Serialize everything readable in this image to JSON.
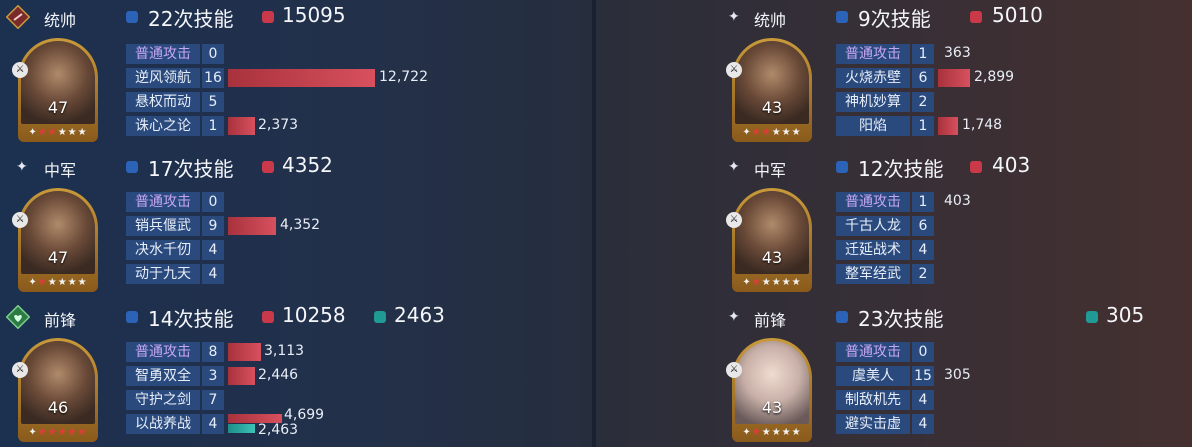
{
  "left": {
    "commander": {
      "role": "统帅",
      "casts": "22次技能",
      "damage": "15095",
      "level": "47",
      "skills": [
        {
          "name": "普通攻击",
          "count": "0",
          "dmg": "",
          "dmg_fraction": 0
        },
        {
          "name": "逆风领航",
          "count": "16",
          "dmg": "12,722",
          "dmg_fraction": 1.0
        },
        {
          "name": "悬权而动",
          "count": "5",
          "dmg": "",
          "dmg_fraction": 0
        },
        {
          "name": "诛心之论",
          "count": "1",
          "dmg": "2,373",
          "dmg_fraction": 0.19
        }
      ]
    },
    "middle": {
      "role": "中军",
      "casts": "17次技能",
      "damage": "4352",
      "level": "47",
      "skills": [
        {
          "name": "普通攻击",
          "count": "0",
          "dmg": "",
          "dmg_fraction": 0
        },
        {
          "name": "销兵偃武",
          "count": "9",
          "dmg": "4,352",
          "dmg_fraction": 0.34
        },
        {
          "name": "决水千仞",
          "count": "4",
          "dmg": "",
          "dmg_fraction": 0
        },
        {
          "name": "动于九天",
          "count": "4",
          "dmg": "",
          "dmg_fraction": 0
        }
      ]
    },
    "vanguard": {
      "role": "前锋",
      "casts": "14次技能",
      "damage": "10258",
      "heal": "2463",
      "level": "46",
      "skills": [
        {
          "name": "普通攻击",
          "count": "8",
          "dmg": "3,113",
          "dmg_fraction": 0.24
        },
        {
          "name": "智勇双全",
          "count": "3",
          "dmg": "2,446",
          "dmg_fraction": 0.19
        },
        {
          "name": "守护之剑",
          "count": "7",
          "dmg": "",
          "dmg_fraction": 0
        },
        {
          "name": "以战养战",
          "count": "4",
          "dmg": "4,699",
          "dmg_fraction": 0.37,
          "heal": "2,463",
          "heal_fraction": 0.19
        }
      ]
    }
  },
  "right": {
    "commander": {
      "role": "统帅",
      "casts": "9次技能",
      "damage": "5010",
      "level": "43",
      "skills": [
        {
          "name": "普通攻击",
          "count": "1",
          "dmg": "363",
          "dmg_fraction": 0
        },
        {
          "name": "火烧赤壁",
          "count": "6",
          "dmg": "2,899",
          "dmg_fraction": 0.23
        },
        {
          "name": "神机妙算",
          "count": "2",
          "dmg": "",
          "dmg_fraction": 0
        },
        {
          "name": "阳焰",
          "count": "1",
          "dmg": "1,748",
          "dmg_fraction": 0.14
        }
      ]
    },
    "middle": {
      "role": "中军",
      "casts": "12次技能",
      "damage": "403",
      "level": "43",
      "skills": [
        {
          "name": "普通攻击",
          "count": "1",
          "dmg": "403",
          "dmg_fraction": 0
        },
        {
          "name": "千古人龙",
          "count": "6",
          "dmg": "",
          "dmg_fraction": 0
        },
        {
          "name": "迁延战术",
          "count": "4",
          "dmg": "",
          "dmg_fraction": 0
        },
        {
          "name": "整军经武",
          "count": "2",
          "dmg": "",
          "dmg_fraction": 0
        }
      ]
    },
    "vanguard": {
      "role": "前锋",
      "casts": "23次技能",
      "heal": "305",
      "level": "43",
      "skills": [
        {
          "name": "普通攻击",
          "count": "0",
          "dmg": "",
          "dmg_fraction": 0
        },
        {
          "name": "虞美人",
          "count": "15",
          "dmg": "305",
          "dmg_fraction": 0
        },
        {
          "name": "制敌机先",
          "count": "4",
          "dmg": "",
          "dmg_fraction": 0
        },
        {
          "name": "避实击虚",
          "count": "4",
          "dmg": "",
          "dmg_fraction": 0
        }
      ]
    }
  },
  "colors": {
    "damage": "#c9394a",
    "casts": "#2b63b8",
    "heal": "#1f9a94",
    "skill_basic": "#c6a6f2"
  },
  "icons": {
    "star": "★",
    "four_point_star": "✦"
  }
}
